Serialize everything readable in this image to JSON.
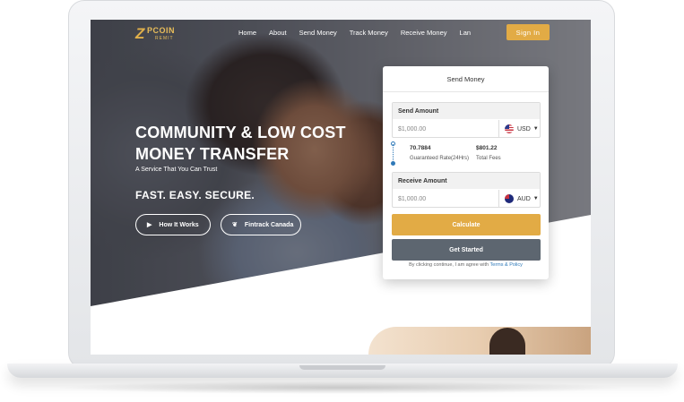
{
  "brand": {
    "logo_mark": "Z",
    "logo_word": "PCOIN",
    "logo_sub": "REMIT"
  },
  "nav": {
    "items": [
      "Home",
      "About",
      "Send Money",
      "Track Money",
      "Receive Money",
      "Lan"
    ],
    "signin_label": "Sign In"
  },
  "hero": {
    "headline_line1": "COMMUNITY & LOW COST",
    "headline_line2": "MONEY TRANSFER",
    "tagline": "A Service That You Can Trust",
    "slogan": "FAST. EASY. SECURE.",
    "btn_how": "How It Works",
    "btn_fintrack": "Fintrack Canada"
  },
  "send_card": {
    "title": "Send Money",
    "send_label": "Send Amount",
    "send_value": "$1,000.00",
    "send_currency": "USD",
    "rate_value": "70.7884",
    "rate_label": "Guaranteed Rate(24Hrs)",
    "fee_value": "$801.22",
    "fee_label": "Total Fees",
    "receive_label": "Receive Amount",
    "receive_value": "$1,000.00",
    "receive_currency": "AUD",
    "calculate_label": "Calculate",
    "get_started_label": "Get Started",
    "terms_text": "By clicking continue, I am agree with",
    "terms_link": "Terms & Policy"
  },
  "colors": {
    "accent": "#e2ab45",
    "secondary": "#5d6670",
    "link": "#2f79b8"
  },
  "icons": {
    "play": "play-icon",
    "pin": "pin-icon",
    "caret": "chevron-down-icon"
  }
}
